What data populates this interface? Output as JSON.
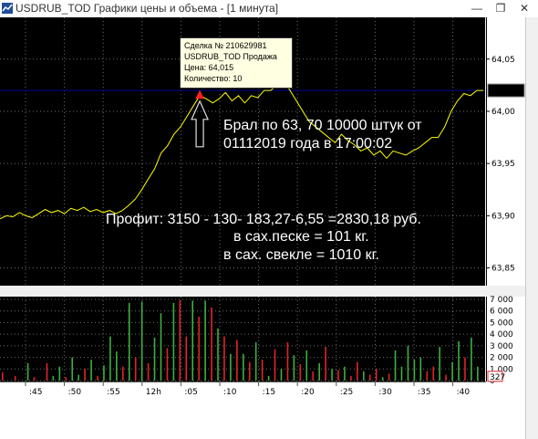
{
  "window": {
    "title": "USDRUB_TOD Графики цены и объема - [1 минута]",
    "minimize": "—",
    "restore": "❐",
    "close": "✕",
    "colors": {
      "background": "#000000",
      "price_line": "#ffff00",
      "current_level": "#00008b",
      "buy_volume": "#3cb043",
      "sell_volume": "#e0232a",
      "grid": "#6e6e6e"
    }
  },
  "tooltip": {
    "deal": "Сделка № 210629981",
    "instrument": "USDRUB_TOD Продажа",
    "price": "Цена: 64,015",
    "quantity": "Количество: 10"
  },
  "annotations": {
    "line1": "Брал по 63, 70   10000 штук от",
    "line2": "01112019 года в 17:00:02",
    "line3": "Профит:  3150  - 130- 183,27-6,55 =2830,18 руб.",
    "line4": "в сах.песке              = 101 кг.",
    "line5": "в сах. свекле             =  1010 кг."
  },
  "chart_data": [
    {
      "type": "line",
      "series": [
        {
          "values": [
            63.897,
            63.9,
            63.899,
            63.903,
            63.9,
            63.898,
            63.902,
            63.906,
            63.903,
            63.905,
            63.902,
            63.907,
            63.905,
            63.908,
            63.904,
            63.906,
            63.903,
            63.905,
            63.902,
            63.905,
            63.91,
            63.916,
            63.925,
            63.935,
            63.945,
            63.96,
            63.967,
            63.978,
            63.985,
            63.995,
            64.005,
            64.015,
            64.012,
            64.008,
            64.012,
            64.018,
            64.01,
            64.015,
            64.008,
            64.015,
            64.013,
            64.02,
            64.02,
            64.025,
            64.03,
            64.02,
            64.01,
            64.0,
            63.99,
            63.985,
            63.98,
            63.975,
            63.97,
            63.978,
            63.972,
            63.968,
            63.962,
            63.965,
            63.958,
            63.962,
            63.955,
            63.962,
            63.96,
            63.958,
            63.962,
            63.965,
            63.97,
            63.975,
            63.975,
            63.985,
            64.0,
            64.01,
            64.017,
            64.015,
            64.02,
            64.02
          ]
        }
      ],
      "y_ticks": [
        "64,05",
        "64,00",
        "63,95",
        "63,90",
        "63,85"
      ],
      "ylim": [
        63.833,
        64.09
      ],
      "current_price": "64,0200",
      "current_level": 64.02,
      "marker": {
        "index": 31,
        "value": 64.015
      },
      "grid": true
    },
    {
      "type": "bar",
      "y_ticks": [
        "7 000",
        "6 000",
        "5 000",
        "4 000",
        "3 000",
        "2 000",
        "1 000",
        "0"
      ],
      "ylim": [
        0,
        7000
      ],
      "bars": [
        {
          "v": 700,
          "side": "sell"
        },
        {
          "v": 0,
          "side": "buy"
        },
        {
          "v": 400,
          "side": "sell"
        },
        {
          "v": 0,
          "side": "buy"
        },
        {
          "v": 1500,
          "side": "buy"
        },
        {
          "v": 300,
          "side": "sell"
        },
        {
          "v": 0,
          "side": "buy"
        },
        {
          "v": 1500,
          "side": "sell"
        },
        {
          "v": 400,
          "side": "buy"
        },
        {
          "v": 1200,
          "side": "buy"
        },
        {
          "v": 300,
          "side": "sell"
        },
        {
          "v": 2000,
          "side": "buy"
        },
        {
          "v": 500,
          "side": "buy"
        },
        {
          "v": 1000,
          "side": "sell"
        },
        {
          "v": 1800,
          "side": "buy"
        },
        {
          "v": 400,
          "side": "sell"
        },
        {
          "v": 1300,
          "side": "buy"
        },
        {
          "v": 3800,
          "side": "buy"
        },
        {
          "v": 2500,
          "side": "buy"
        },
        {
          "v": 1200,
          "side": "sell"
        },
        {
          "v": 6700,
          "side": "buy"
        },
        {
          "v": 2000,
          "side": "sell"
        },
        {
          "v": 6800,
          "side": "buy"
        },
        {
          "v": 1500,
          "side": "sell"
        },
        {
          "v": 3700,
          "side": "buy"
        },
        {
          "v": 5800,
          "side": "buy"
        },
        {
          "v": 2800,
          "side": "sell"
        },
        {
          "v": 6700,
          "side": "buy"
        },
        {
          "v": 6900,
          "side": "sell"
        },
        {
          "v": 3800,
          "side": "sell"
        },
        {
          "v": 6900,
          "side": "buy"
        },
        {
          "v": 5500,
          "side": "sell"
        },
        {
          "v": 6900,
          "side": "buy"
        },
        {
          "v": 6300,
          "side": "sell"
        },
        {
          "v": 4500,
          "side": "buy"
        },
        {
          "v": 3800,
          "side": "sell"
        },
        {
          "v": 2300,
          "side": "buy"
        },
        {
          "v": 3500,
          "side": "sell"
        },
        {
          "v": 2300,
          "side": "buy"
        },
        {
          "v": 1600,
          "side": "sell"
        },
        {
          "v": 3300,
          "side": "buy"
        },
        {
          "v": 1800,
          "side": "sell"
        },
        {
          "v": 400,
          "side": "buy"
        },
        {
          "v": 2700,
          "side": "sell"
        },
        {
          "v": 1000,
          "side": "buy"
        },
        {
          "v": 3300,
          "side": "sell"
        },
        {
          "v": 2200,
          "side": "buy"
        },
        {
          "v": 1400,
          "side": "sell"
        },
        {
          "v": 2600,
          "side": "buy"
        },
        {
          "v": 800,
          "side": "sell"
        },
        {
          "v": 1500,
          "side": "buy"
        },
        {
          "v": 2900,
          "side": "sell"
        },
        {
          "v": 1000,
          "side": "buy"
        },
        {
          "v": 900,
          "side": "sell"
        },
        {
          "v": 1200,
          "side": "buy"
        },
        {
          "v": 400,
          "side": "sell"
        },
        {
          "v": 1600,
          "side": "sell"
        },
        {
          "v": 800,
          "side": "buy"
        },
        {
          "v": 500,
          "side": "sell"
        },
        {
          "v": 1000,
          "side": "sell"
        },
        {
          "v": 300,
          "side": "buy"
        },
        {
          "v": 600,
          "side": "sell"
        },
        {
          "v": 2600,
          "side": "buy"
        },
        {
          "v": 1200,
          "side": "buy"
        },
        {
          "v": 3000,
          "side": "buy"
        },
        {
          "v": 1800,
          "side": "buy"
        },
        {
          "v": 2000,
          "side": "buy"
        },
        {
          "v": 800,
          "side": "sell"
        },
        {
          "v": 1200,
          "side": "sell"
        },
        {
          "v": 2900,
          "side": "buy"
        },
        {
          "v": 500,
          "side": "sell"
        },
        {
          "v": 1600,
          "side": "buy"
        },
        {
          "v": 3400,
          "side": "buy"
        },
        {
          "v": 2000,
          "side": "sell"
        },
        {
          "v": 3700,
          "side": "buy"
        },
        {
          "v": 1200,
          "side": "buy"
        }
      ],
      "last_value": "327"
    }
  ],
  "time_axis": [
    ":45",
    ":50",
    ":55",
    "12h",
    ":05",
    ":10",
    ":15",
    ":20",
    ":25",
    ":30",
    ":35",
    ":40"
  ]
}
